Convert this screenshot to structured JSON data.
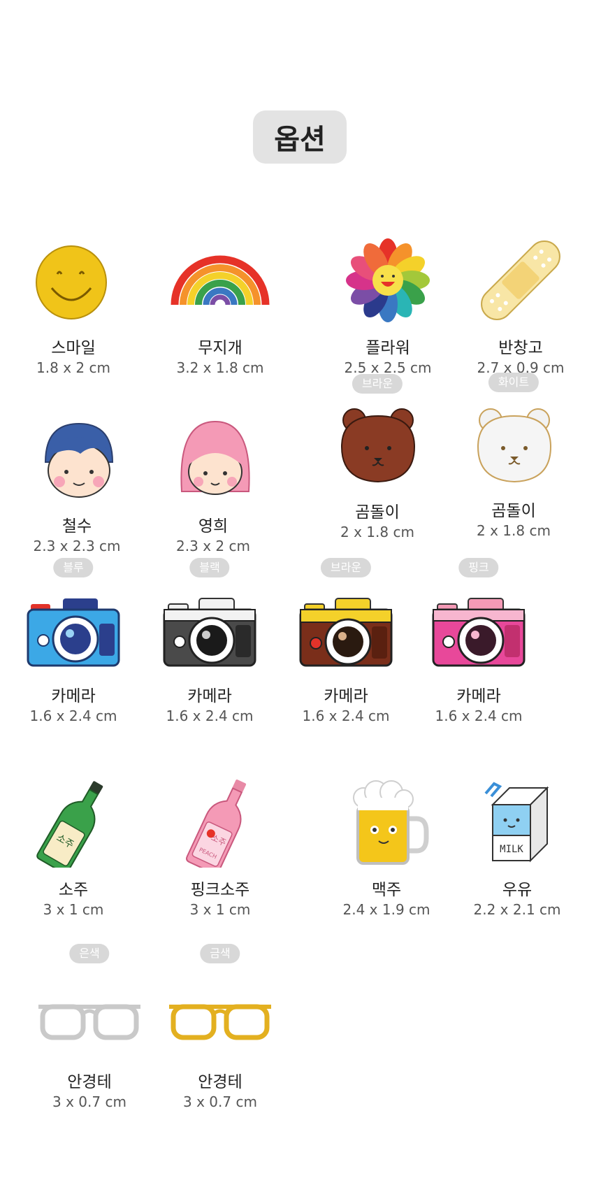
{
  "title": "옵션",
  "items": [
    {
      "name": "스마일",
      "size": "1.8 x 2 cm",
      "tag": "",
      "icon": "smile-pin-icon"
    },
    {
      "name": "무지개",
      "size": "3.2 x 1.8 cm",
      "tag": "",
      "icon": "rainbow-pin-icon"
    },
    {
      "name": "플라워",
      "size": "2.5 x 2.5 cm",
      "tag": "",
      "icon": "flower-pin-icon"
    },
    {
      "name": "반창고",
      "size": "2.7 x 0.9 cm",
      "tag": "",
      "icon": "bandage-pin-icon"
    },
    {
      "name": "철수",
      "size": "2.3 x 2.3 cm",
      "tag": "",
      "icon": "boy-pin-icon"
    },
    {
      "name": "영희",
      "size": "2.3 x 2 cm",
      "tag": "",
      "icon": "girl-pin-icon"
    },
    {
      "name": "곰돌이",
      "size": "2 x 1.8 cm",
      "tag": "브라운",
      "icon": "brown-bear-pin-icon"
    },
    {
      "name": "곰돌이",
      "size": "2 x 1.8 cm",
      "tag": "화이트",
      "icon": "white-bear-pin-icon"
    },
    {
      "name": "카메라",
      "size": "1.6 x 2.4 cm",
      "tag": "블루",
      "icon": "blue-camera-pin-icon"
    },
    {
      "name": "카메라",
      "size": "1.6 x 2.4 cm",
      "tag": "블랙",
      "icon": "black-camera-pin-icon"
    },
    {
      "name": "카메라",
      "size": "1.6 x 2.4 cm",
      "tag": "브라운",
      "icon": "brown-camera-pin-icon"
    },
    {
      "name": "카메라",
      "size": "1.6 x 2.4 cm",
      "tag": "핑크",
      "icon": "pink-camera-pin-icon"
    },
    {
      "name": "소주",
      "size": "3 x 1 cm",
      "tag": "",
      "icon": "soju-bottle-pin-icon"
    },
    {
      "name": "핑크소주",
      "size": "3 x 1 cm",
      "tag": "",
      "icon": "pink-soju-bottle-pin-icon"
    },
    {
      "name": "맥주",
      "size": "2.4 x 1.9 cm",
      "tag": "",
      "icon": "beer-mug-pin-icon"
    },
    {
      "name": "우유",
      "size": "2.2 x 2.1 cm",
      "tag": "",
      "icon": "milk-carton-pin-icon"
    },
    {
      "name": "안경테",
      "size": "3 x 0.7 cm",
      "tag": "은색",
      "icon": "silver-glasses-pin-icon"
    },
    {
      "name": "안경테",
      "size": "3 x 0.7 cm",
      "tag": "금색",
      "icon": "gold-glasses-pin-icon"
    }
  ],
  "pin_texts": {
    "soju_label": "소주",
    "peach_label": "PEACH",
    "milk_label": "MILK"
  }
}
